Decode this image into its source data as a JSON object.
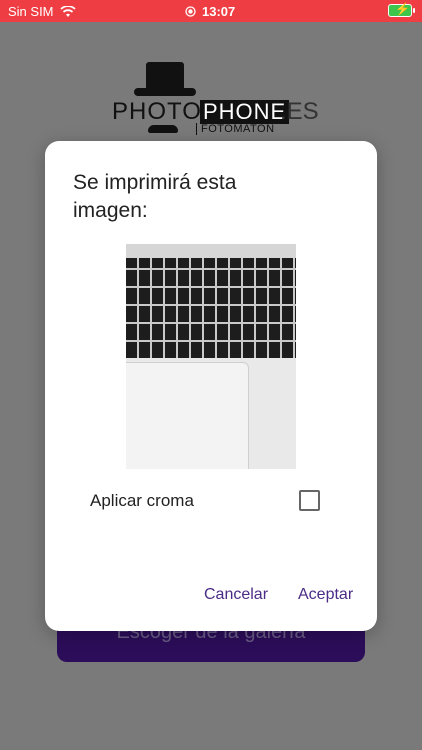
{
  "status_bar": {
    "carrier": "Sin SIM",
    "time": "13:07",
    "icons": [
      "wifi-icon",
      "record-icon",
      "battery-charging-icon"
    ]
  },
  "logo": {
    "photo": "PHOTO",
    "phone": "PHONE",
    "es": ".ES",
    "subtitle": "FOTOMATON"
  },
  "background": {
    "button_label": "Escoger de la galería"
  },
  "dialog": {
    "title": "Se imprimirá esta imagen:",
    "checkbox_label": "Aplicar croma",
    "checkbox_checked": false,
    "cancel_label": "Cancelar",
    "accept_label": "Aceptar"
  },
  "colors": {
    "status_bar": "#ee3e43",
    "accent": "#4a2c86",
    "overlay": "#7a7a7a"
  }
}
